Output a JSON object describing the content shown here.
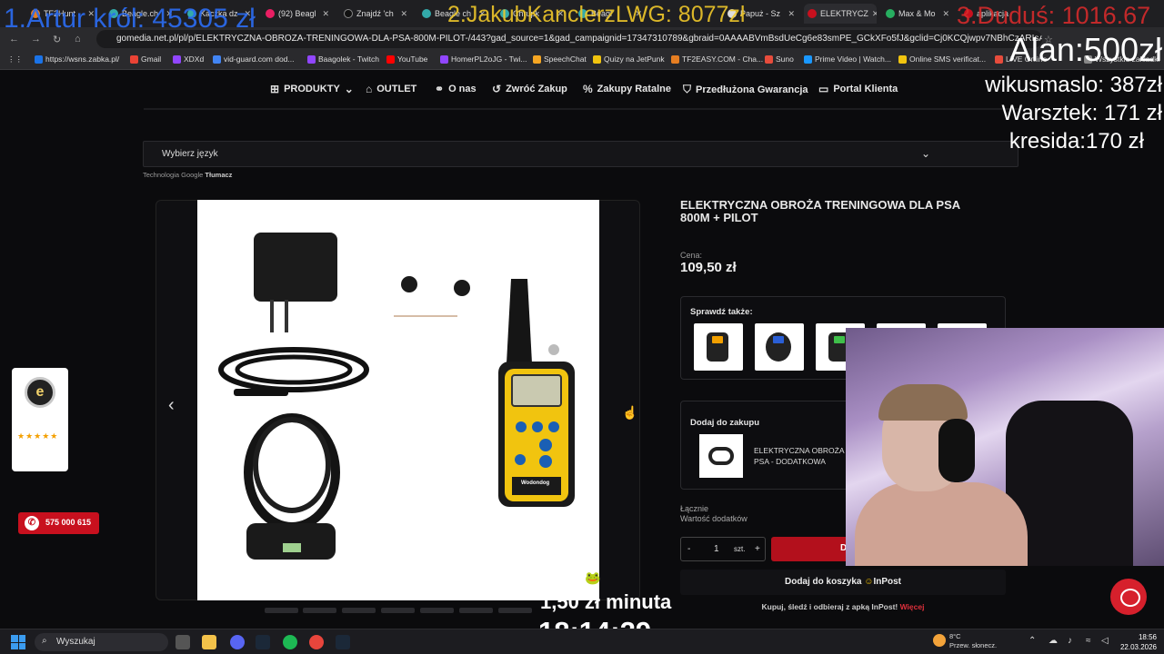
{
  "browser": {
    "tabs": [
      {
        "label": "TF2Hunt"
      },
      {
        "label": "Beagle.ch"
      },
      {
        "label": "Kaczka dz"
      },
      {
        "label": "(92) Beagl"
      },
      {
        "label": "Znajdź 'ch"
      },
      {
        "label": "Beagle ch"
      },
      {
        "label": "Chrupk"
      },
      {
        "label": "Beagl"
      },
      {
        "label": "Papuż - Sz"
      },
      {
        "label": "ELEKTRYCZ"
      },
      {
        "label": "Max & Mo"
      },
      {
        "label": "aplikacja"
      }
    ],
    "url": "gomedia.net.pl/pl/p/ELEKTRYCZNA-OBROZA-TRENINGOWA-DLA-PSA-800M-PILOT-/443?gad_source=1&gad_campaignid=17347310789&gbraid=0AAAABVmBsdUeCg6e83smPE_GCkXFo5fJ&gclid=Cj0KCQjwpv7NBhCzARIsADkIfWyc98QcIt",
    "bookmarks": [
      {
        "label": "https://wsns.zabka.pl/",
        "color": "#1a73e8"
      },
      {
        "label": "Gmail",
        "color": "#ea4335"
      },
      {
        "label": "XDXd",
        "color": "#9146ff"
      },
      {
        "label": "vid-guard.com dod...",
        "color": "#4285f4"
      },
      {
        "label": "Baagolek - Twitch",
        "color": "#9146ff"
      },
      {
        "label": "YouTube",
        "color": "#ff0000"
      },
      {
        "label": "HomerPL2oJG - Twi...",
        "color": "#9146ff"
      },
      {
        "label": "SpeechChat",
        "color": "#f5a623"
      },
      {
        "label": "Quizy na JetPunk",
        "color": "#f1c40f"
      },
      {
        "label": "TF2EASY.COM - Cha...",
        "color": "#e67e22"
      },
      {
        "label": "Suno",
        "color": "#e74c3c"
      },
      {
        "label": "Prime Video | Watch...",
        "color": "#1a98ff"
      },
      {
        "label": "Online SMS verificat...",
        "color": "#f1c40f"
      },
      {
        "label": "LIVE Online",
        "color": "#e74c3c"
      },
      {
        "label": "Wszystkie zakładki",
        "color": "#888888"
      }
    ]
  },
  "overlays": {
    "first": "1.Artur król: 45305 zł",
    "second": "2.JakubKanclerzLWG: 8077zł",
    "third": "3.Duduś: 1016.67",
    "alan": "Alan:500zł",
    "wikusmaslo": "wikusmaslo: 387zł",
    "warsztek": "Warsztek: 171 zł",
    "kresida": "kresida:170 zł",
    "rate": "1,50 zł minuta",
    "timer": "18:14:29"
  },
  "site_nav": {
    "items": [
      {
        "label": "PRODUKTY",
        "icon": "grid-icon",
        "dropdown": true
      },
      {
        "label": "OUTLET",
        "icon": "tag-icon"
      },
      {
        "label": "O nas",
        "icon": "handshake-icon"
      },
      {
        "label": "Zwróć Zakup",
        "icon": "return-icon"
      },
      {
        "label": "Zakupy Ratalne",
        "icon": "percent-icon"
      },
      {
        "label": "Przedłużona Gwarancja",
        "icon": "shield-icon"
      },
      {
        "label": "Portal Klienta",
        "icon": "book-icon"
      }
    ]
  },
  "language": {
    "select_label": "Wybierz język",
    "powered_prefix": "Technologia",
    "google": "Google",
    "translate": "Tłumacz"
  },
  "sidebar": {
    "stars": "★★★★★",
    "phone": "575 000 615"
  },
  "product": {
    "title": "ELEKTRYCZNA OBROŻA TRENINGOWA DLA PSA 800M + PILOT",
    "price_label": "Cena:",
    "price": "109,50 zł",
    "check_also": "Sprawdź także:",
    "add_to_purchase": "Dodaj do zakupu",
    "addon_name": "ELEKTRYCZNA OBROŻA DLA PSA - DODATKOWA",
    "total_label": "Łącznie",
    "addons_value_label": "Wartość dodatków",
    "qty_minus": "-",
    "qty": "1",
    "qty_unit": "szt.",
    "qty_plus": "+",
    "add_button": "D",
    "inpost_button": "Dodaj do koszyka",
    "inpost_brand": "InPost",
    "inpost_note": "Kupuj, śledź i odbieraj z apką InPost!",
    "inpost_more": "Więcej",
    "remote_brand": "Wodondog"
  },
  "taskbar": {
    "search": "Wyszukaj",
    "weather_temp": "8°C",
    "weather_desc": "Przew. słonecz.",
    "time": "18:56",
    "date": "22.03.2026"
  }
}
